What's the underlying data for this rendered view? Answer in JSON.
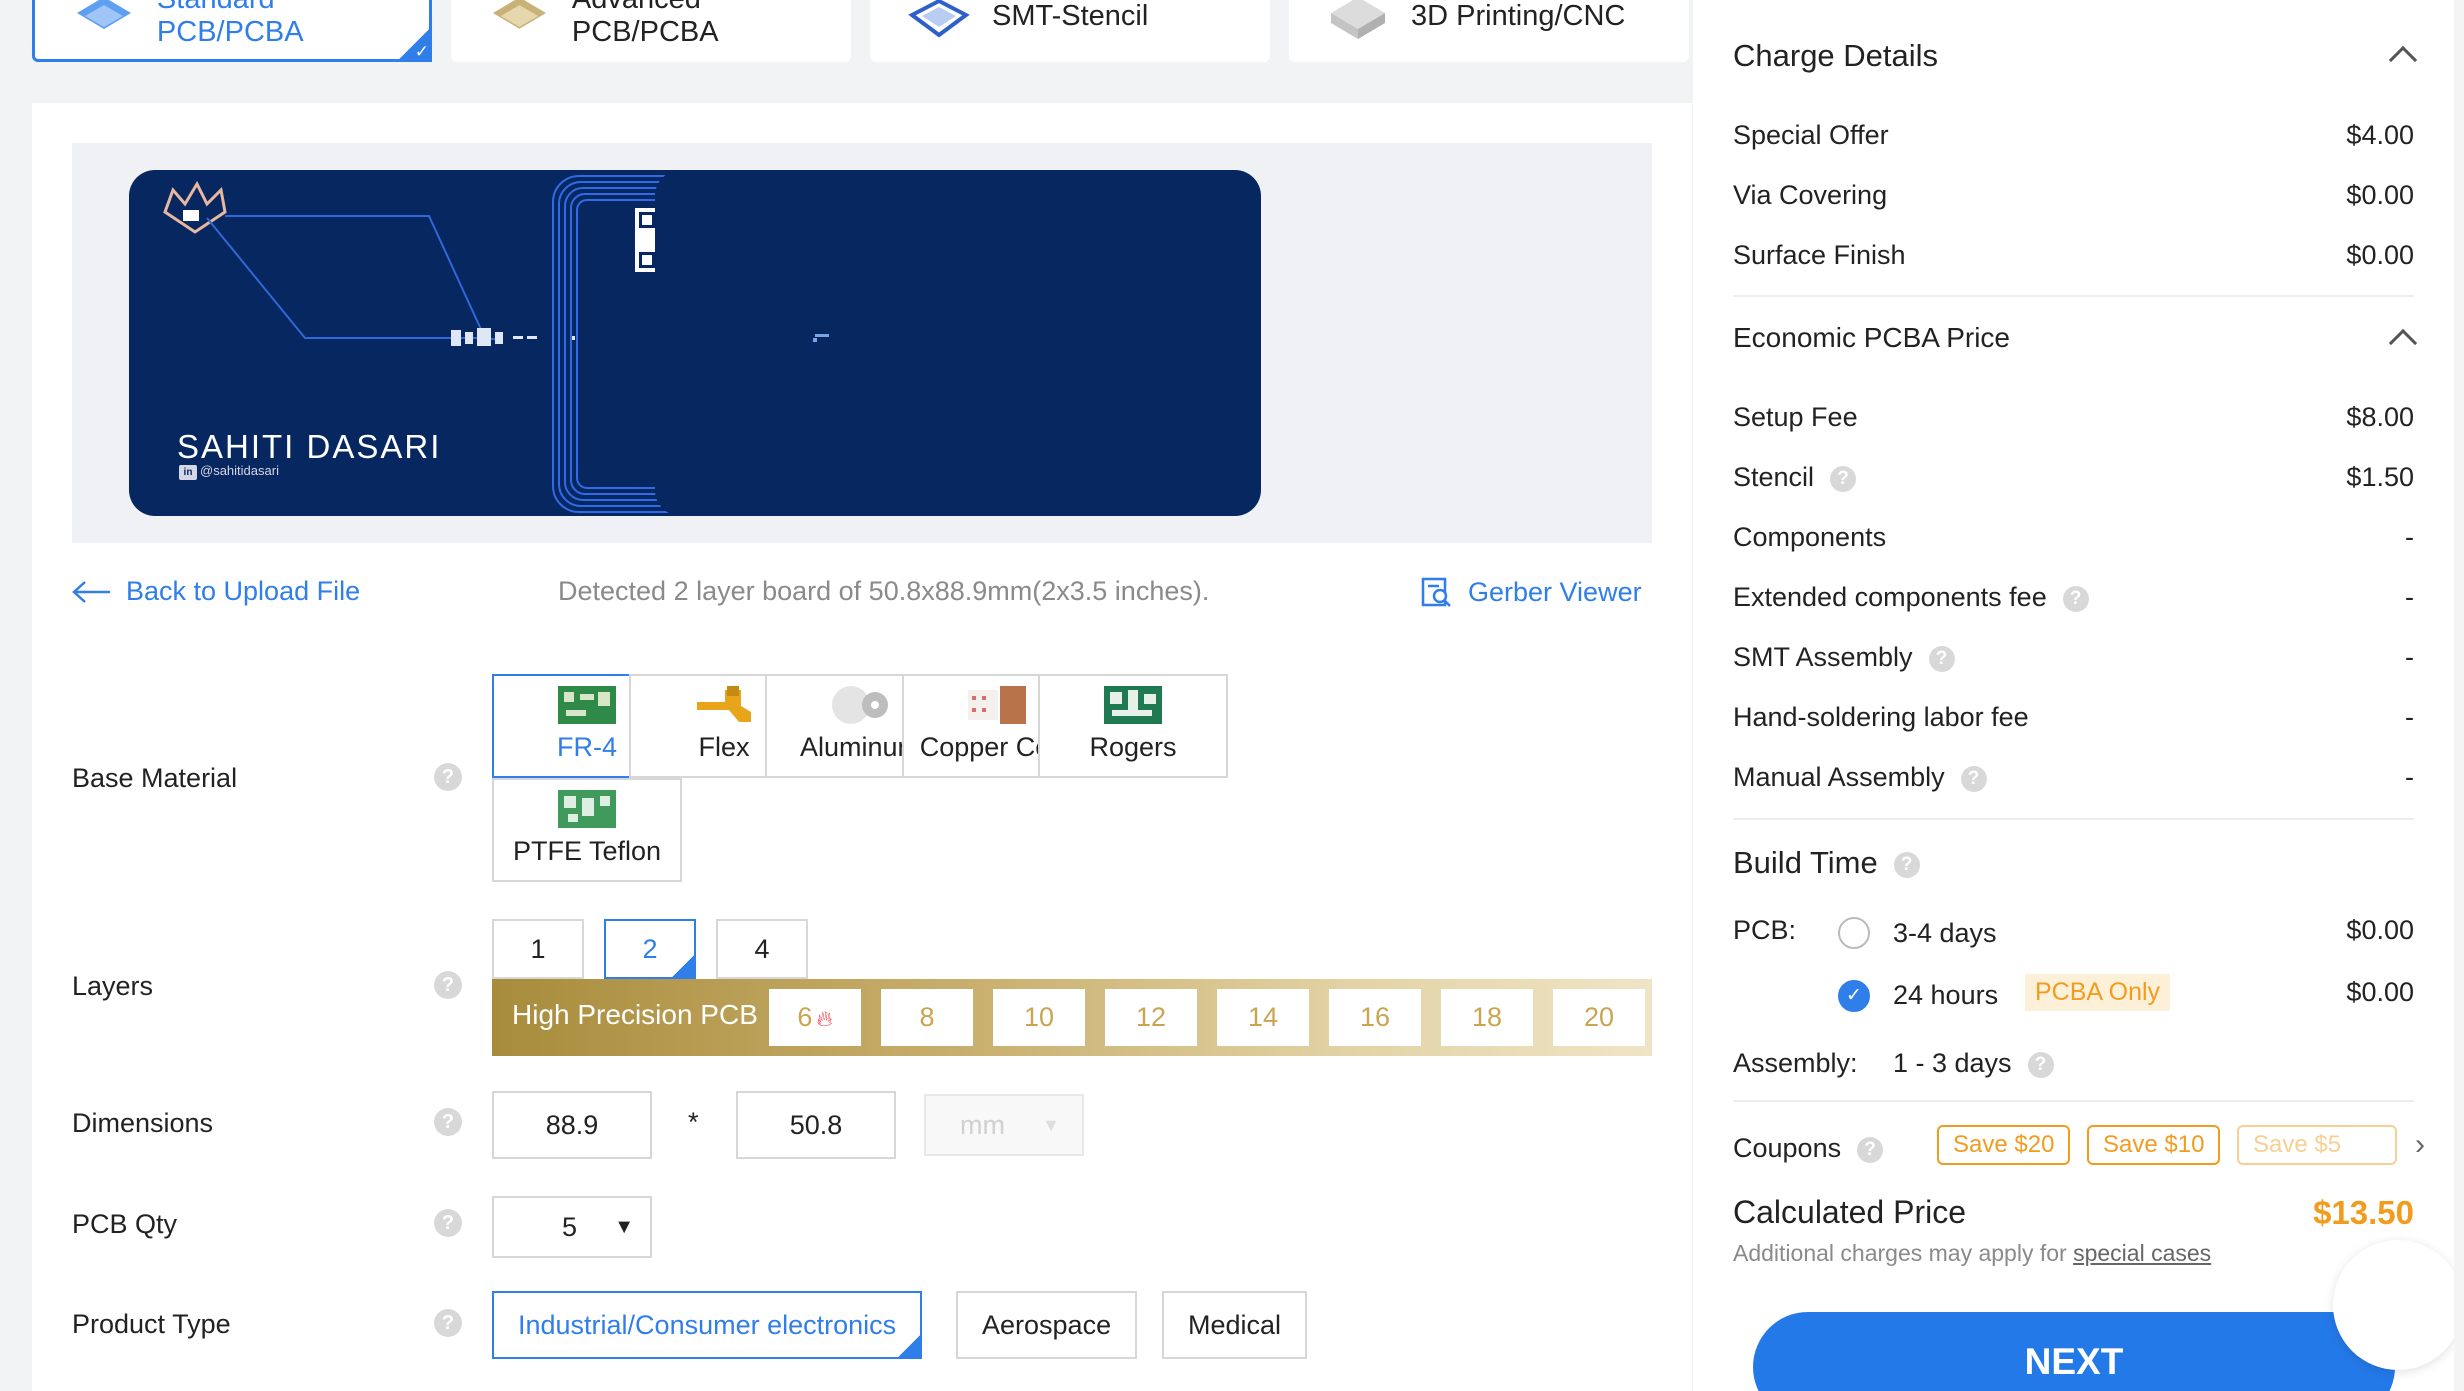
{
  "tabs": [
    {
      "label": "Standard PCB/PCBA",
      "icon": "standard-pcb-icon",
      "active": true
    },
    {
      "label": "Advanced PCB/PCBA",
      "icon": "advanced-pcb-icon",
      "active": false
    },
    {
      "label": "SMT-Stencil",
      "icon": "smt-stencil-icon",
      "active": false
    },
    {
      "label": "3D Printing/CNC",
      "icon": "3d-printing-icon",
      "active": false
    }
  ],
  "preview": {
    "front_name": "SAHITI DASARI",
    "front_handle": "@sahitidasari",
    "front_handle_icon": "in"
  },
  "upload": {
    "back_label": "Back to Upload File",
    "detected_text": "Detected 2 layer board of 50.8x88.9mm(2x3.5 inches).",
    "gerber_label": "Gerber Viewer"
  },
  "form": {
    "base_material": {
      "label": "Base Material",
      "help": "?",
      "options": [
        "FR-4",
        "Flex",
        "Aluminum",
        "Copper Core",
        "Rogers",
        "PTFE Teflon"
      ],
      "selected": "FR-4"
    },
    "layers": {
      "label": "Layers",
      "help": "?",
      "options": [
        "1",
        "2",
        "4"
      ],
      "selected": "2",
      "high_precision_label": "High Precision PCB",
      "high_precision_options": [
        "6",
        "8",
        "10",
        "12",
        "14",
        "16",
        "18",
        "20"
      ]
    },
    "dimensions": {
      "label": "Dimensions",
      "help": "?",
      "length": "88.9",
      "separator": "*",
      "width": "50.8",
      "unit": "mm"
    },
    "pcb_qty": {
      "label": "PCB Qty",
      "help": "?",
      "value": "5"
    },
    "product_type": {
      "label": "Product Type",
      "help": "?",
      "options": [
        "Industrial/Consumer electronics",
        "Aerospace",
        "Medical"
      ],
      "selected": "Industrial/Consumer electronics"
    }
  },
  "charges": {
    "title": "Charge Details",
    "items": [
      {
        "label": "Special Offer",
        "value": "$4.00"
      },
      {
        "label": "Via Covering",
        "value": "$0.00"
      },
      {
        "label": "Surface Finish",
        "value": "$0.00"
      }
    ]
  },
  "pcba": {
    "title": "Economic PCBA Price",
    "items": [
      {
        "label": "Setup Fee",
        "value": "$8.00",
        "help": false
      },
      {
        "label": "Stencil",
        "value": "$1.50",
        "help": true
      },
      {
        "label": "Components",
        "value": "-",
        "help": false
      },
      {
        "label": "Extended components fee",
        "value": "-",
        "help": true
      },
      {
        "label": "SMT Assembly",
        "value": "-",
        "help": true
      },
      {
        "label": "Hand-soldering labor fee",
        "value": "-",
        "help": false
      },
      {
        "label": "Manual Assembly",
        "value": "-",
        "help": true
      }
    ]
  },
  "build_time": {
    "title": "Build Time",
    "pcb_label": "PCB:",
    "options": [
      {
        "label": "3-4 days",
        "price": "$0.00",
        "checked": false
      },
      {
        "label": "24 hours",
        "price": "$0.00",
        "checked": true,
        "tag": "PCBA Only"
      }
    ],
    "assembly_label": "Assembly:",
    "assembly_value": "1 - 3 days"
  },
  "coupons": {
    "label": "Coupons",
    "items": [
      "Save $20",
      "Save $10",
      "Save $5"
    ]
  },
  "total": {
    "label": "Calculated Price",
    "value": "$13.50",
    "note_prefix": "Additional charges may apply for ",
    "note_link": "special cases"
  },
  "next_label": "NEXT",
  "colors": {
    "accent": "#2f7ee9",
    "price": "#f29c1f",
    "board": "#06275f"
  }
}
